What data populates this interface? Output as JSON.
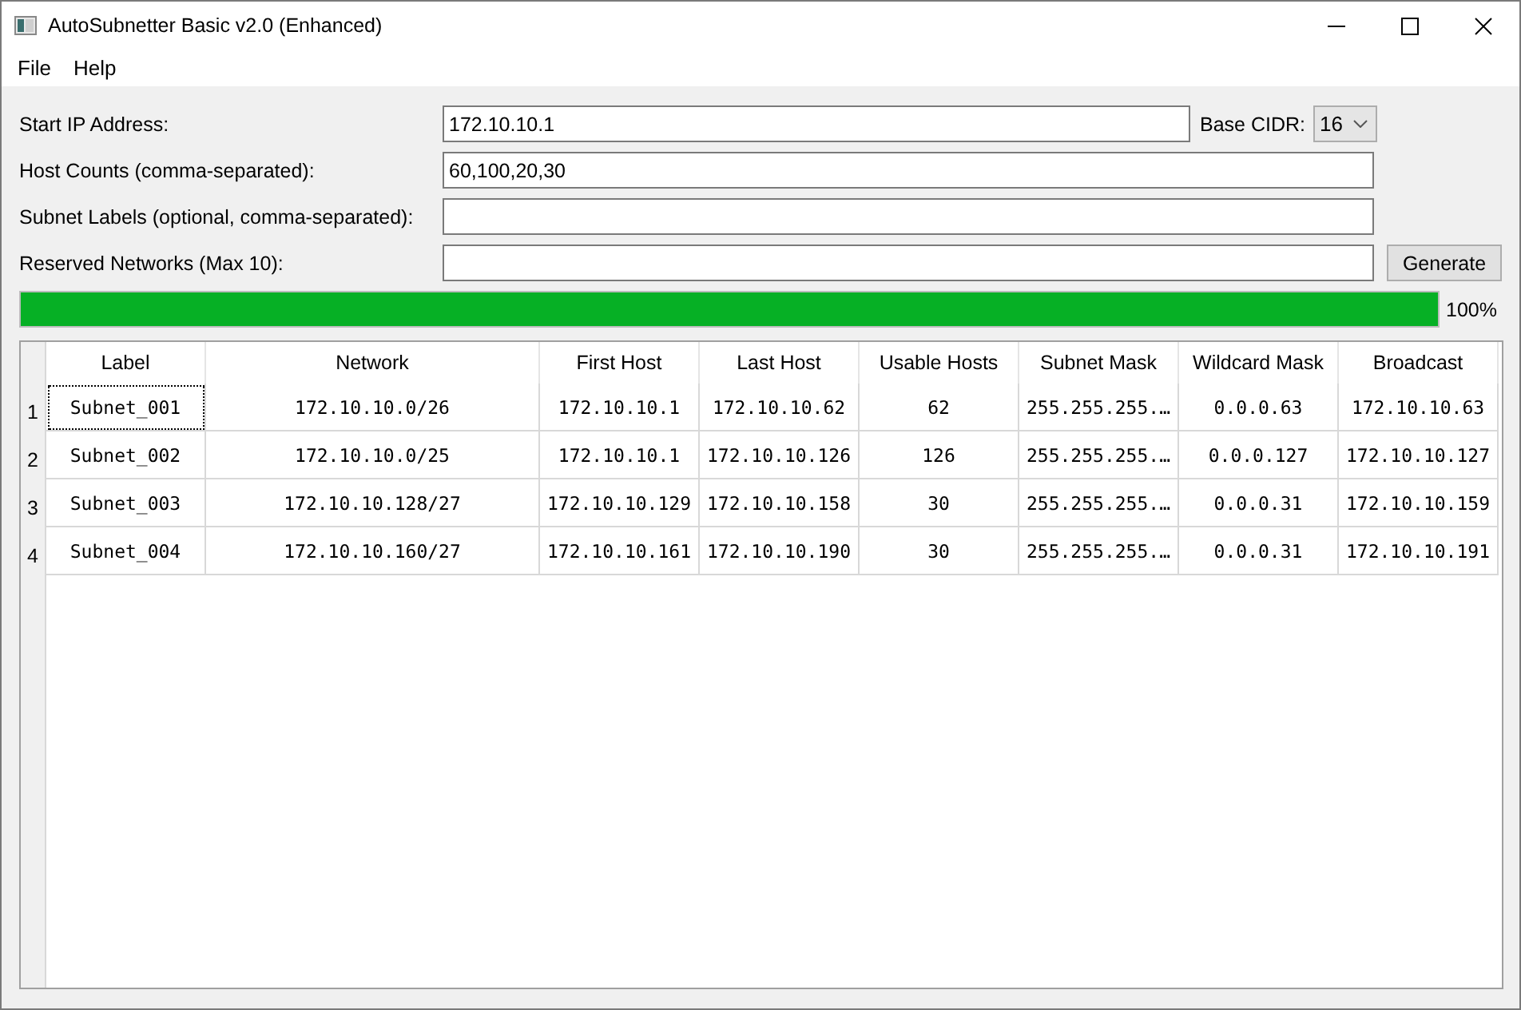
{
  "window": {
    "title": "AutoSubnetter Basic v2.0 (Enhanced)"
  },
  "menu": [
    "File",
    "Help"
  ],
  "form": {
    "fields": [
      {
        "label": "Start IP Address:",
        "value": "172.10.10.1"
      },
      {
        "label": "Host Counts (comma-separated):",
        "value": "60,100,20,30"
      },
      {
        "label": "Subnet Labels (optional, comma-separated):"
      },
      {
        "label": "Reserved Networks (Max 10):"
      }
    ],
    "base_cidr": {
      "label": "Base CIDR:",
      "value": "16"
    },
    "generate_button": "Generate"
  },
  "progress": {
    "level": 1,
    "reading": "100%"
  },
  "table": {
    "columns": [
      "Label",
      "Network",
      "First Host",
      "Last Host",
      "Usable Hosts",
      "Subnet Mask",
      "Wildcard Mask",
      "Broadcast"
    ],
    "rows": [
      {
        "index": "1",
        "focused": true,
        "cells": [
          "Subnet_001",
          "172.10.10.0/26",
          "172.10.10.1",
          "172.10.10.62",
          "62",
          "255.255.255.…",
          "0.0.0.63",
          "172.10.10.63"
        ]
      },
      {
        "index": "2",
        "focused": false,
        "cells": [
          "Subnet_002",
          "172.10.10.0/25",
          "172.10.10.1",
          "172.10.10.126",
          "126",
          "255.255.255.…",
          "0.0.0.127",
          "172.10.10.127"
        ]
      },
      {
        "index": "3",
        "focused": false,
        "cells": [
          "Subnet_003",
          "172.10.10.128/27",
          "172.10.10.129",
          "172.10.10.158",
          "30",
          "255.255.255.…",
          "0.0.0.31",
          "172.10.10.159"
        ]
      },
      {
        "index": "4",
        "focused": false,
        "cells": [
          "Subnet_004",
          "172.10.10.160/27",
          "172.10.10.161",
          "172.10.10.190",
          "30",
          "255.255.255.…",
          "0.0.0.31",
          "172.10.10.191"
        ]
      }
    ]
  }
}
